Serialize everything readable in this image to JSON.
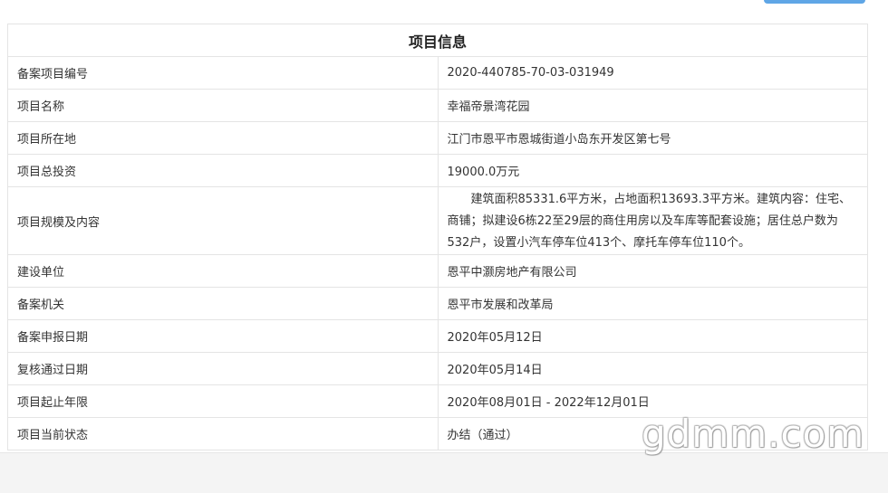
{
  "table": {
    "title": "项目信息",
    "rows": [
      {
        "label": "备案项目编号",
        "value": "2020-440785-70-03-031949"
      },
      {
        "label": "项目名称",
        "value": "幸福帝景湾花园"
      },
      {
        "label": "项目所在地",
        "value": "江门市恩平市恩城街道小岛东开发区第七号"
      },
      {
        "label": "项目总投资",
        "value": "19000.0万元"
      },
      {
        "label": "项目规模及内容",
        "value": "建筑面积85331.6平方米，占地面积13693.3平方米。建筑内容：住宅、商铺；拟建设6栋22至29层的商住用房以及车库等配套设施；居住总户数为532户，设置小汽车停车位413个、摩托车停车位110个。"
      },
      {
        "label": "建设单位",
        "value": "恩平中灏房地产有限公司"
      },
      {
        "label": "备案机关",
        "value": "恩平市发展和改革局"
      },
      {
        "label": "备案申报日期",
        "value": "2020年05月12日"
      },
      {
        "label": "复核通过日期",
        "value": "2020年05月14日"
      },
      {
        "label": "项目起止年限",
        "value": "2020年08月01日 - 2022年12月01日"
      },
      {
        "label": "项目当前状态",
        "value": "办结（通过）"
      }
    ]
  },
  "watermark": "gdmm.com",
  "colors": {
    "border": "#e4e4e4",
    "accent_button": "#5fa6e6",
    "text": "#333333"
  }
}
